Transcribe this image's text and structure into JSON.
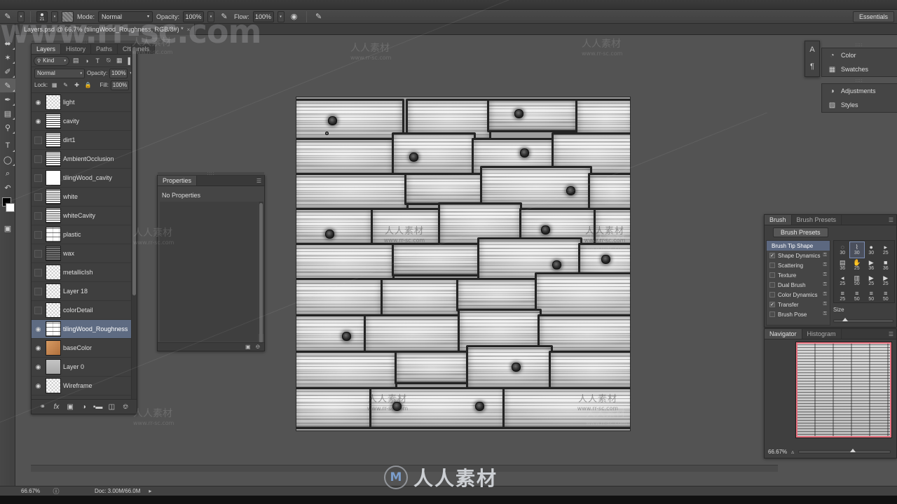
{
  "app": {
    "workspace_label": "Essentials"
  },
  "options_bar": {
    "brush_size": "21",
    "mode_label": "Mode:",
    "mode_value": "Normal",
    "opacity_label": "Opacity:",
    "opacity_value": "100%",
    "flow_label": "Flow:",
    "flow_value": "100%",
    "airbrush_icon": "airbrush-icon",
    "smoothing_icon": "smoothing-icon",
    "tablet_pressure_icon": "tablet-pressure-icon"
  },
  "document": {
    "tab_title": "Layers.psd @ 66.7% (tilingWood_Roughness, RGB/8#) *",
    "close_glyph": "×"
  },
  "toolbar": {
    "tools": [
      {
        "name": "move-tool",
        "glyph": "⬌"
      },
      {
        "name": "magic-wand-tool",
        "glyph": "✦"
      },
      {
        "name": "eyedropper-tool",
        "glyph": "✐"
      },
      {
        "name": "brush-tool",
        "glyph": "✎",
        "selected": true
      },
      {
        "name": "clone-stamp-tool",
        "glyph": "✒"
      },
      {
        "name": "gradient-tool",
        "glyph": "▤"
      },
      {
        "name": "dodge-tool",
        "glyph": "○"
      },
      {
        "name": "type-tool",
        "glyph": "T"
      },
      {
        "name": "ellipse-shape-tool",
        "glyph": "◯"
      },
      {
        "name": "zoom-tool",
        "glyph": "⌕"
      },
      {
        "name": "history-brush-tool",
        "glyph": "↶"
      }
    ],
    "foreground_color": "#000000",
    "background_color": "#ffffff",
    "screen_mode_icon": "screen-mode-icon"
  },
  "layers_panel": {
    "tabs": [
      {
        "label": "Layers",
        "active": true
      },
      {
        "label": "History",
        "active": false
      },
      {
        "label": "Paths",
        "active": false
      },
      {
        "label": "Channels",
        "active": false
      }
    ],
    "filter_label": "Kind",
    "filter_icons": [
      "pixel-filter-icon",
      "adjustment-filter-icon",
      "type-filter-icon",
      "shape-filter-icon",
      "smart-object-filter-icon"
    ],
    "blend_mode": "Normal",
    "opacity_label": "Opacity:",
    "opacity_value": "100%",
    "lock_label": "Lock:",
    "lock_icons": [
      "lock-transparent-pixels-icon",
      "lock-image-pixels-icon",
      "lock-position-icon",
      "lock-all-icon"
    ],
    "fill_label": "Fill:",
    "fill_value": "100%",
    "layers": [
      {
        "name": "light",
        "visible": true,
        "thumb": "checker",
        "selected": false
      },
      {
        "name": "cavity",
        "visible": true,
        "thumb": "noise",
        "selected": false
      },
      {
        "name": "dirt1",
        "visible": false,
        "thumb": "noise",
        "selected": false
      },
      {
        "name": "AmbientOcclusion",
        "visible": false,
        "thumb": "noise",
        "selected": false
      },
      {
        "name": "tilingWood_cavity",
        "visible": false,
        "thumb": "white",
        "selected": false
      },
      {
        "name": "white",
        "visible": false,
        "thumb": "noise",
        "selected": false
      },
      {
        "name": "whiteCavity",
        "visible": false,
        "thumb": "noise",
        "selected": false
      },
      {
        "name": "plastic",
        "visible": false,
        "thumb": "rough",
        "selected": false
      },
      {
        "name": "wax",
        "visible": false,
        "thumb": "dark",
        "selected": false
      },
      {
        "name": "metallicIsh",
        "visible": false,
        "thumb": "checker",
        "selected": false
      },
      {
        "name": "Layer 18",
        "visible": false,
        "thumb": "checker",
        "selected": false
      },
      {
        "name": "colorDetail",
        "visible": false,
        "thumb": "checker",
        "selected": false
      },
      {
        "name": "tilingWood_Roughness",
        "visible": true,
        "thumb": "rough",
        "selected": true
      },
      {
        "name": "baseColor",
        "visible": true,
        "thumb": "brown",
        "selected": false
      },
      {
        "name": "Layer 0",
        "visible": true,
        "thumb": "gray",
        "selected": false
      },
      {
        "name": "Wireframe",
        "visible": true,
        "thumb": "checker",
        "selected": false
      }
    ],
    "footer_icons": [
      {
        "name": "link-layers-icon",
        "glyph": "⚭"
      },
      {
        "name": "layer-style-fx-icon",
        "glyph": "fx"
      },
      {
        "name": "add-layer-mask-icon",
        "glyph": "▣"
      },
      {
        "name": "adjustment-layer-icon",
        "glyph": "◑"
      },
      {
        "name": "new-group-icon",
        "glyph": "▰"
      },
      {
        "name": "new-layer-icon",
        "glyph": "⬚"
      },
      {
        "name": "delete-layer-icon",
        "glyph": "Ὕ1"
      }
    ]
  },
  "properties_panel": {
    "tab_label": "Properties",
    "body_text": "No Properties"
  },
  "right_dock": {
    "narrow_icons": [
      {
        "name": "character-panel-icon",
        "glyph": "A"
      },
      {
        "name": "paragraph-panel-icon",
        "glyph": "¶"
      }
    ],
    "groups": [
      {
        "items": [
          {
            "label": "Color",
            "icon": "color-panel-icon",
            "glyph": "◕"
          },
          {
            "label": "Swatches",
            "icon": "swatches-panel-icon",
            "glyph": "▦"
          }
        ]
      },
      {
        "items": [
          {
            "label": "Adjustments",
            "icon": "adjustments-panel-icon",
            "glyph": "◑"
          },
          {
            "label": "Styles",
            "icon": "styles-panel-icon",
            "glyph": "▨"
          }
        ]
      }
    ]
  },
  "brush_panel": {
    "tabs": [
      {
        "label": "Brush",
        "active": true
      },
      {
        "label": "Brush Presets",
        "active": false
      }
    ],
    "presets_button": "Brush Presets",
    "options": [
      {
        "label": "Brush Tip Shape",
        "checked": null,
        "header": true
      },
      {
        "label": "Shape Dynamics",
        "checked": true,
        "header": false
      },
      {
        "label": "Scattering",
        "checked": false,
        "header": false
      },
      {
        "label": "Texture",
        "checked": false,
        "header": false
      },
      {
        "label": "Dual Brush",
        "checked": false,
        "header": false
      },
      {
        "label": "Color Dynamics",
        "checked": false,
        "header": false
      },
      {
        "label": "Transfer",
        "checked": true,
        "header": false
      },
      {
        "label": "Brush Pose",
        "checked": false,
        "header": false
      }
    ],
    "tip_grid": [
      {
        "size": "30",
        "selected": false
      },
      {
        "size": "30",
        "selected": true
      },
      {
        "size": "30",
        "selected": false
      },
      {
        "size": "25",
        "selected": false
      },
      {
        "size": "36",
        "selected": false
      },
      {
        "size": "25",
        "selected": false
      },
      {
        "size": "36",
        "selected": false
      },
      {
        "size": "36",
        "selected": false
      },
      {
        "size": "25",
        "selected": false
      },
      {
        "size": "50",
        "selected": false
      },
      {
        "size": "25",
        "selected": false
      },
      {
        "size": "25",
        "selected": false
      },
      {
        "size": "25",
        "selected": false
      },
      {
        "size": "50",
        "selected": false
      },
      {
        "size": "50",
        "selected": false
      },
      {
        "size": "50",
        "selected": false
      }
    ],
    "size_label": "Size"
  },
  "navigator_panel": {
    "tabs": [
      {
        "label": "Navigator",
        "active": true
      },
      {
        "label": "Histogram",
        "active": false
      }
    ],
    "zoom_value": "66.67%",
    "view_box_color": "#e8707e"
  },
  "status_bar": {
    "zoom": "66.67%",
    "doc_label": "Doc: 3.00M/66.0M",
    "arrow_glyph": "▸"
  },
  "watermarks": {
    "site": "www.rr-sc.com",
    "brand_cn": "人人素材",
    "big_site": "www.rr-sc.com",
    "logo_letter": "M"
  },
  "canvas": {
    "texture_name": "tilingWood_Roughness",
    "zoom_percent": "66.67%"
  }
}
